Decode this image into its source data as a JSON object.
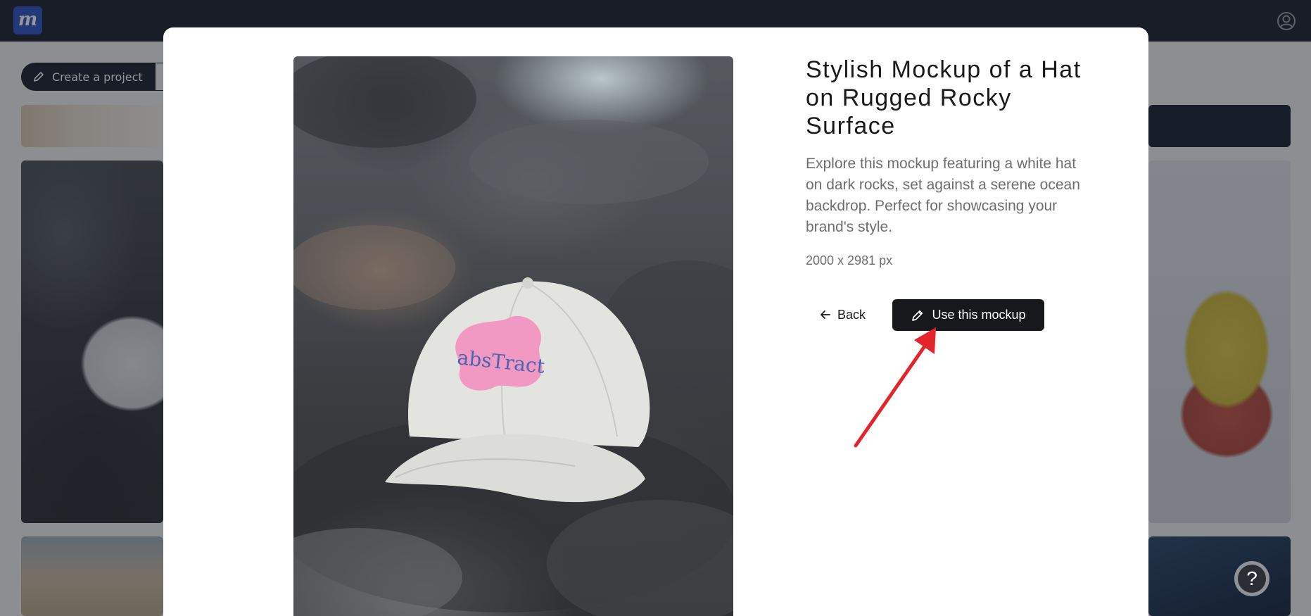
{
  "topbar": {
    "logo_letter": "m",
    "account_icon": "user-circle-icon"
  },
  "toolbar": {
    "create_label": "Create a project",
    "create_icon": "pencil-icon"
  },
  "modal": {
    "title": "Stylish Mockup of a Hat on Rugged Rocky Surface",
    "description": "Explore this mockup featuring a white hat on dark rocks, set against a serene ocean backdrop. Perfect for showcasing your brand's style.",
    "dimensions": "2000 x 2981 px",
    "back_label": "Back",
    "back_icon": "arrow-left-icon",
    "use_label": "Use this mockup",
    "use_icon": "pencil-icon",
    "preview_hat_text": "absTract"
  },
  "help": {
    "label": "?"
  },
  "colors": {
    "topbar": "#1d2330",
    "logo": "#2f55c4",
    "primary_button": "#16181c",
    "annotation_arrow": "#e3242b",
    "hat_logo_blob": "#f199c2",
    "hat_logo_text": "#4a64b5"
  }
}
